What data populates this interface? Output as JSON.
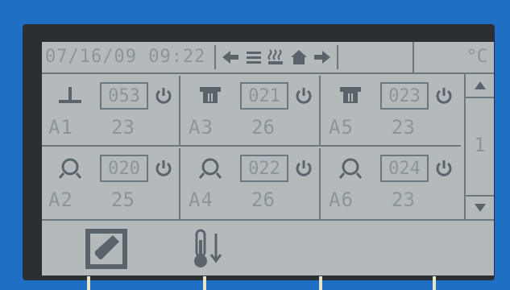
{
  "status": {
    "datetime": "07/16/09 09:22",
    "unit": "°C"
  },
  "zones": [
    {
      "label": "A1",
      "setpoint": "053",
      "temp": "23",
      "icon": "radiant-floor-icon"
    },
    {
      "label": "A3",
      "setpoint": "021",
      "temp": "26",
      "icon": "ceiling-unit-icon"
    },
    {
      "label": "A5",
      "setpoint": "023",
      "temp": "23",
      "icon": "ceiling-unit-icon"
    },
    {
      "label": "A2",
      "setpoint": "020",
      "temp": "25",
      "icon": "fan-coil-icon"
    },
    {
      "label": "A4",
      "setpoint": "022",
      "temp": "26",
      "icon": "fan-coil-icon"
    },
    {
      "label": "A6",
      "setpoint": "024",
      "temp": "23",
      "icon": "fan-coil-icon"
    }
  ],
  "pager": {
    "page": "1"
  },
  "colors": {
    "lcd": "#b4babc",
    "bezel": "#2b2f33",
    "frame": "#1f6fc4",
    "ink": "#6c777e"
  }
}
